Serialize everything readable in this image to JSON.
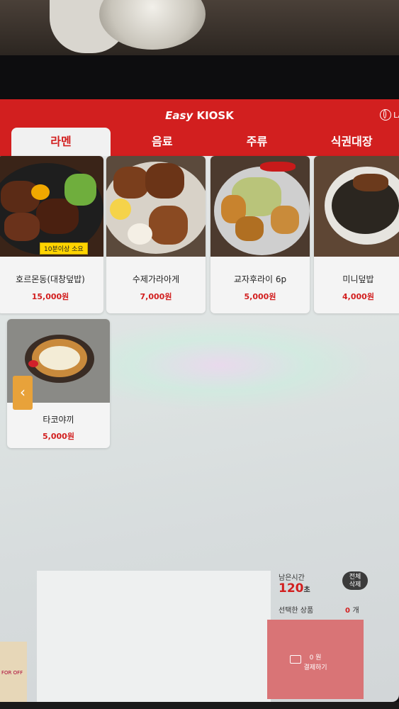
{
  "header": {
    "brand_easy": "Easy",
    "brand_kiosk": "KIOSK",
    "language_label": "LA"
  },
  "tabs": [
    {
      "label": "라멘",
      "active": true
    },
    {
      "label": "음료",
      "active": false
    },
    {
      "label": "주류",
      "active": false
    },
    {
      "label": "식권대장",
      "active": false
    }
  ],
  "products": [
    {
      "name": "호르몬동(대창덮밥)",
      "price": "15,000원",
      "badge": "10분이상 소요"
    },
    {
      "name": "수제가라아게",
      "price": "7,000원"
    },
    {
      "name": "교자후라이 6p",
      "price": "5,000원"
    },
    {
      "name": "미니덮밥",
      "price": "4,000원"
    },
    {
      "name": "타코야끼",
      "price": "5,000원"
    }
  ],
  "summary": {
    "remaining_time_label": "남은시간",
    "remaining_time_value": "120",
    "remaining_time_unit": "초",
    "clear_all_label_1": "전체",
    "clear_all_label_2": "삭제",
    "selected_items_label": "선택한 상품",
    "selected_items_count": "0",
    "selected_items_unit": "개",
    "pay_amount": "0 원",
    "pay_label": "결제하기"
  },
  "colors": {
    "brand_red": "#d21f1f",
    "prev_button": "#e8a23a",
    "pay_button": "#d97476",
    "badge": "#ffd400"
  },
  "icons": [
    "globe-icon",
    "chevron-left-icon",
    "card-icon"
  ],
  "poster_text": "FOR OFF"
}
